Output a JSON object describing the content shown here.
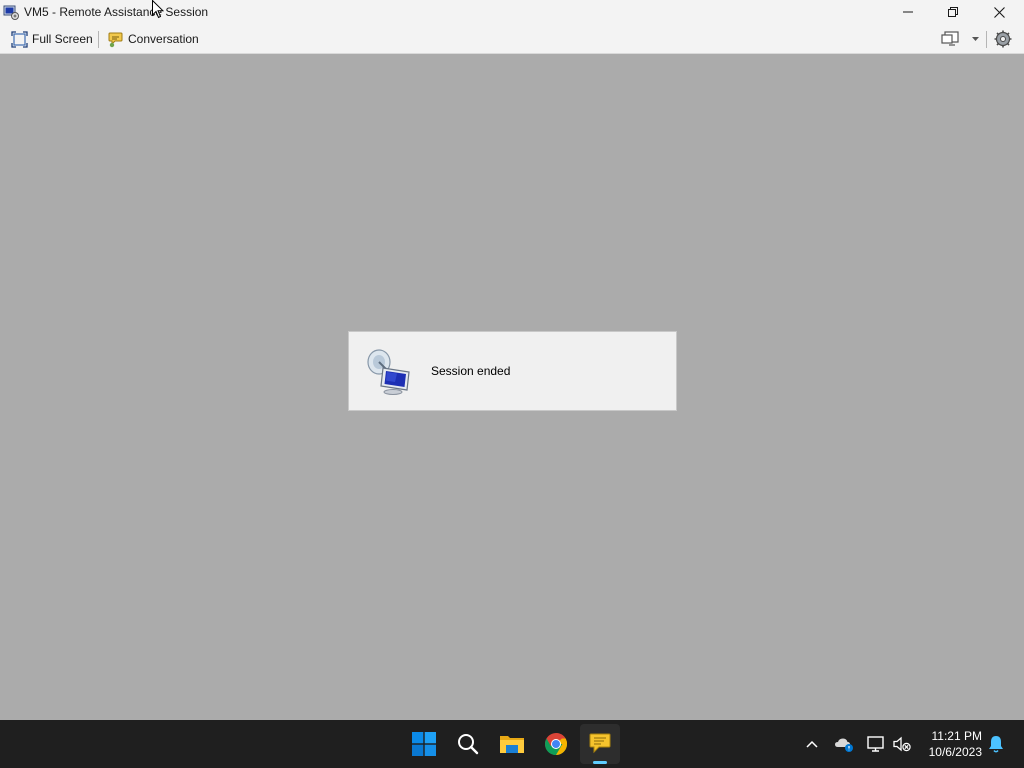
{
  "window": {
    "title": "VM5 - Remote Assistance Session",
    "app_icon": "remote-assistance-icon",
    "controls": [
      "minimize-icon",
      "restore-icon",
      "close-icon"
    ]
  },
  "toolbar": {
    "full_screen_label": "Full Screen",
    "full_screen_icon": "full-screen-icon",
    "conversation_label": "Conversation",
    "conversation_icon": "chat-icon",
    "display_icon": "display-settings-icon",
    "settings_icon": "settings-icon"
  },
  "dialog": {
    "message": "Session ended",
    "icon": "remote-assistance-monitor-icon"
  },
  "taskbar": {
    "apps": [
      "windows-start-icon",
      "search-icon",
      "file-explorer-icon",
      "chrome-icon",
      "remote-assistance-icon"
    ],
    "active_app": "remote-assistance-icon",
    "tray": [
      "chevron-up-icon",
      "onedrive-icon",
      "network-icon",
      "volume-muted-icon",
      "notification-bell-icon"
    ],
    "time": "11:21 PM",
    "date": "10/6/2023"
  },
  "colors": {
    "remote_background": "#ababab",
    "taskbar": "#1f1f1f",
    "active_indicator": "#60cdff",
    "windows_blue": "#0078d4"
  }
}
